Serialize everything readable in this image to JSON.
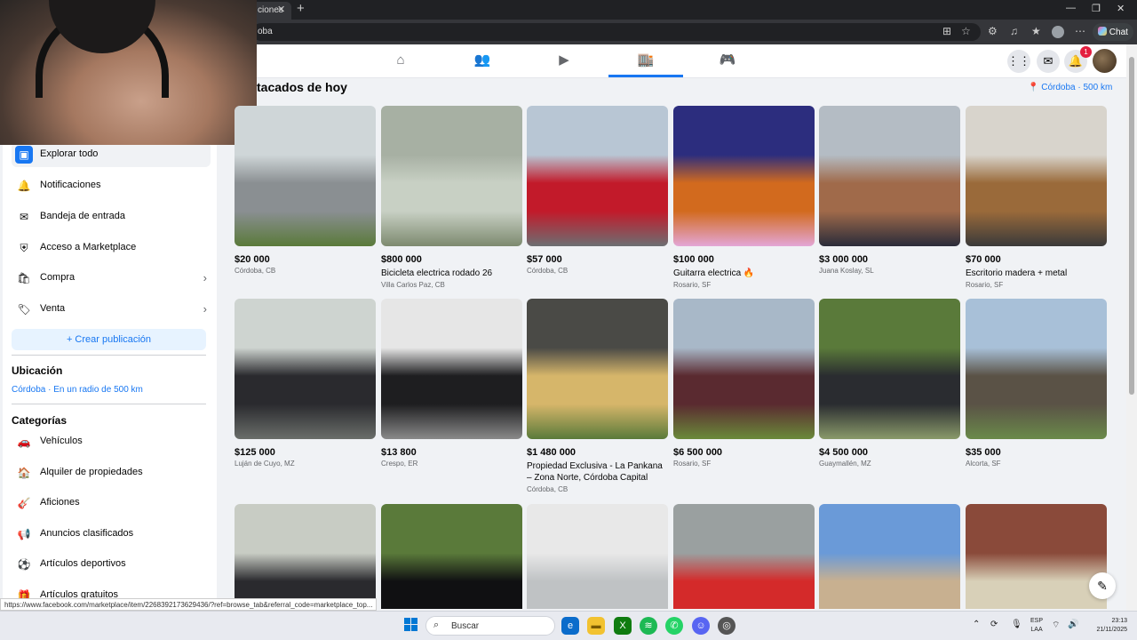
{
  "browser": {
    "tab_title": "ciones",
    "url": "oba",
    "chat_label": "Chat",
    "status_url": "https://www.facebook.com/marketplace/item/2268392173629436/?ref=browse_tab&referral_code=marketplace_top..."
  },
  "header": {
    "notification_count": "1"
  },
  "sidebar": {
    "items": [
      {
        "label": "Explorar todo",
        "icon": "store-icon"
      },
      {
        "label": "Notificaciones",
        "icon": "bell-icon"
      },
      {
        "label": "Bandeja de entrada",
        "icon": "inbox-icon"
      },
      {
        "label": "Acceso a Marketplace",
        "icon": "shield-icon"
      },
      {
        "label": "Compra",
        "icon": "bag-icon"
      },
      {
        "label": "Venta",
        "icon": "tag-icon"
      }
    ],
    "create_label": "+ Crear publicación",
    "location_heading": "Ubicación",
    "location_value": "Córdoba · En un radio de 500 km",
    "categories_heading": "Categorías",
    "categories": [
      {
        "label": "Vehículos",
        "icon": "car-icon"
      },
      {
        "label": "Alquiler de propiedades",
        "icon": "house-icon"
      },
      {
        "label": "Aficiones",
        "icon": "guitar-icon"
      },
      {
        "label": "Anuncios clasificados",
        "icon": "megaphone-icon"
      },
      {
        "label": "Artículos deportivos",
        "icon": "ball-icon"
      },
      {
        "label": "Artículos gratuitos",
        "icon": "gift-icon"
      }
    ]
  },
  "main": {
    "title": "tacados de hoy",
    "location": "Córdoba · 500 km",
    "listings": [
      {
        "price": "$20 000",
        "title": "",
        "location": "Córdoba, CB",
        "colors": [
          "#cfd6d8",
          "#8a8f92",
          "#5a7a3a"
        ]
      },
      {
        "price": "$800 000",
        "title": "Bicicleta electrica rodado 26",
        "location": "Villa Carlos Paz, CB",
        "colors": [
          "#a7b0a3",
          "#c8d0c4",
          "#7d8a6f"
        ]
      },
      {
        "price": "$57 000",
        "title": "",
        "location": "Córdoba, CB",
        "colors": [
          "#b8c6d4",
          "#c21a2a",
          "#6c6f72"
        ]
      },
      {
        "price": "$100 000",
        "title": "Guitarra electrica 🔥",
        "location": "Rosario, SF",
        "colors": [
          "#2c2d7e",
          "#d26a1e",
          "#e3a6d6"
        ]
      },
      {
        "price": "$3 000 000",
        "title": "",
        "location": "Juana Koslay, SL",
        "colors": [
          "#b4bcc4",
          "#a06a4a",
          "#2a2c3a"
        ]
      },
      {
        "price": "$70 000",
        "title": "Escritorio madera + metal",
        "location": "Rosario, SF",
        "colors": [
          "#d8d4cc",
          "#9a6a3a",
          "#3a3a3a"
        ]
      },
      {
        "price": "$125 000",
        "title": "",
        "location": "Luján de Cuyo, MZ",
        "colors": [
          "#ced4d0",
          "#2a2a2e",
          "#6a6e6a"
        ]
      },
      {
        "price": "$13 800",
        "title": "",
        "location": "Crespo, ER",
        "colors": [
          "#e6e6e6",
          "#1e1e20",
          "#8a8a8a"
        ]
      },
      {
        "price": "$1 480 000",
        "title": "Propiedad Exclusiva - La Pankana – Zona Norte, Córdoba Capital",
        "location": "Córdoba, CB",
        "colors": [
          "#4a4a46",
          "#d6b66a",
          "#5a7a3a"
        ]
      },
      {
        "price": "$6 500 000",
        "title": "",
        "location": "Rosario, SF",
        "colors": [
          "#a8b8c8",
          "#5a2a30",
          "#6a8a3a"
        ]
      },
      {
        "price": "$4 500 000",
        "title": "",
        "location": "Guaymallén, MZ",
        "colors": [
          "#5a7a3a",
          "#2a2c30",
          "#8a9a6a"
        ]
      },
      {
        "price": "$35 000",
        "title": "",
        "location": "Alcorta, SF",
        "colors": [
          "#a8c0d8",
          "#5a5246",
          "#6a8a4a"
        ]
      },
      {
        "price": "",
        "title": "",
        "location": "",
        "colors": [
          "#c8ccc4",
          "#2a2a2e",
          "#5a6a4a"
        ]
      },
      {
        "price": "",
        "title": "",
        "location": "",
        "colors": [
          "#5a7a3a",
          "#101012",
          "#3a5a2a"
        ]
      },
      {
        "price": "",
        "title": "",
        "location": "",
        "colors": [
          "#e8e8e8",
          "#bfc2c4",
          "#8a8a8a"
        ]
      },
      {
        "price": "",
        "title": "",
        "location": "",
        "colors": [
          "#9aa0a0",
          "#d42a2a",
          "#f4f4f4"
        ]
      },
      {
        "price": "",
        "title": "",
        "location": "",
        "colors": [
          "#6a9ad8",
          "#c8b090",
          "#5a7a3a"
        ]
      },
      {
        "price": "",
        "title": "",
        "location": "",
        "colors": [
          "#8a4a3a",
          "#d8d0b8",
          "#a8b8c8"
        ]
      }
    ]
  },
  "taskbar": {
    "search_placeholder": "Buscar",
    "lang_top": "ESP",
    "lang_bottom": "LAA",
    "time": "23:13",
    "date": "21/11/2025"
  }
}
